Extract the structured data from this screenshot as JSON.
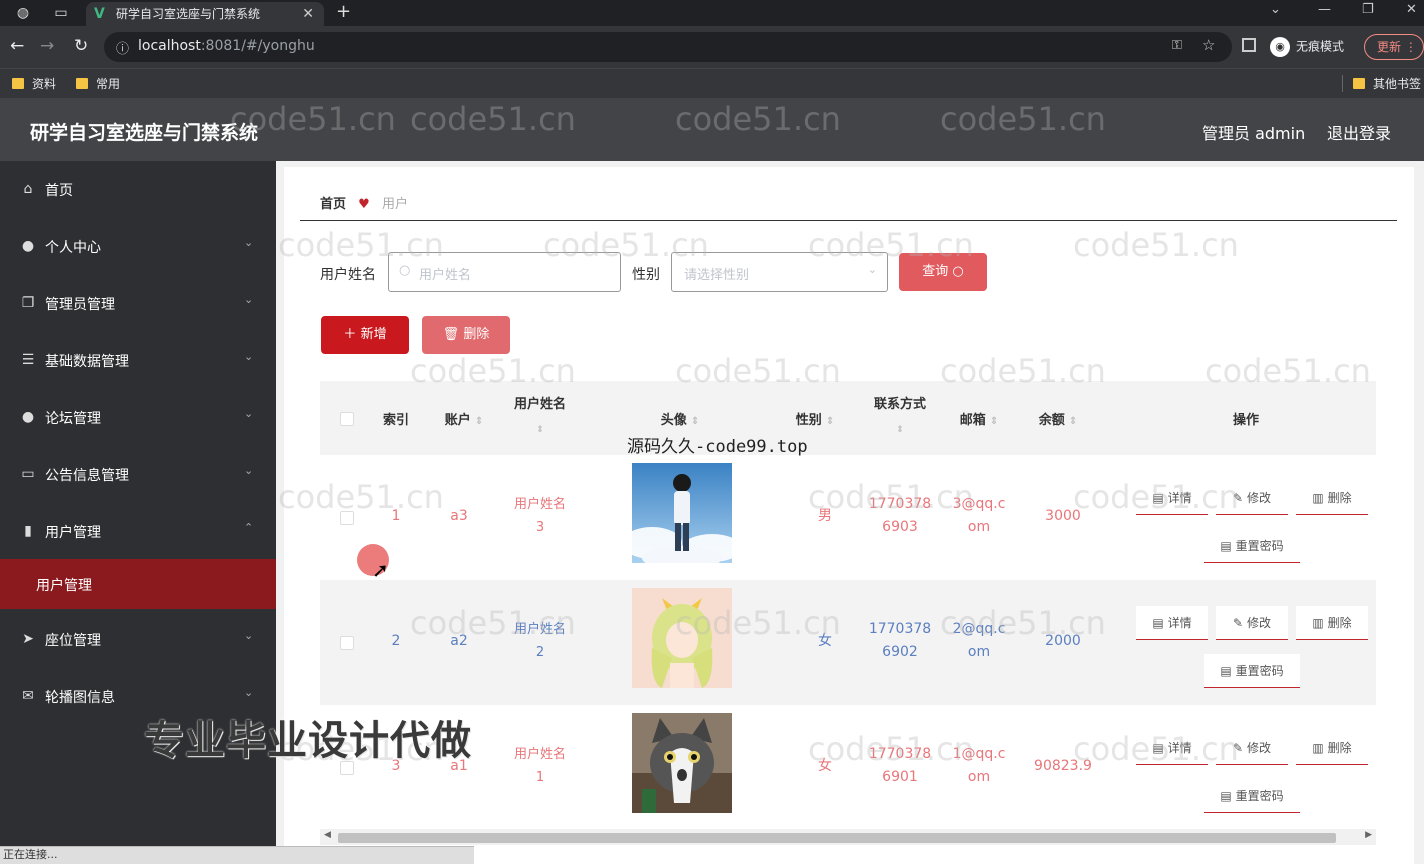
{
  "browser": {
    "tab_title": "研学自习室选座与门禁系统",
    "url_host": "localhost",
    "url_rest": ":8081/#/yonghu",
    "incognito_label": "无痕模式",
    "update_label": "更新",
    "bookmarks": [
      "资料",
      "常用"
    ],
    "other_bookmarks": "其他书签",
    "status_text": "正在连接..."
  },
  "header": {
    "app_title": "研学自习室选座与门禁系统",
    "user": "管理员 admin",
    "logout": "退出登录"
  },
  "sidebar": {
    "items": [
      {
        "label": "首页",
        "icon": "home-icon"
      },
      {
        "label": "个人中心",
        "icon": "user-icon"
      },
      {
        "label": "管理员管理",
        "icon": "copy-icon"
      },
      {
        "label": "基础数据管理",
        "icon": "list-icon"
      },
      {
        "label": "论坛管理",
        "icon": "bulb-icon"
      },
      {
        "label": "公告信息管理",
        "icon": "message-icon"
      },
      {
        "label": "用户管理",
        "icon": "chart-icon"
      },
      {
        "label": "座位管理",
        "icon": "send-icon"
      },
      {
        "label": "轮播图信息",
        "icon": "mail-icon"
      }
    ],
    "active_sub": "用户管理"
  },
  "breadcrumb": {
    "home": "首页",
    "current": "用户"
  },
  "search": {
    "name_label": "用户姓名",
    "name_placeholder": "用户姓名",
    "gender_label": "性别",
    "gender_placeholder": "请选择性别",
    "query_button": "查询"
  },
  "toolbar": {
    "add": "新增",
    "delete": "删除"
  },
  "table": {
    "headers": {
      "index": "索引",
      "account": "账户",
      "name": "用户姓名",
      "avatar": "头像",
      "gender": "性别",
      "contact": "联系方式",
      "email": "邮箱",
      "balance": "余额",
      "actions": "操作"
    },
    "action_labels": {
      "detail": "详情",
      "edit": "修改",
      "delete": "删除",
      "reset": "重置密码"
    },
    "rows": [
      {
        "index": "1",
        "account": "a3",
        "name1": "用户姓名",
        "name2": "3",
        "gender": "男",
        "phone1": "1770378",
        "phone2": "6903",
        "email1": "3@qq.c",
        "email2": "om",
        "balance": "3000",
        "color": "#e8767a"
      },
      {
        "index": "2",
        "account": "a2",
        "name1": "用户姓名",
        "name2": "2",
        "gender": "女",
        "phone1": "1770378",
        "phone2": "6902",
        "email1": "2@qq.c",
        "email2": "om",
        "balance": "2000",
        "color": "#5b7fc0"
      },
      {
        "index": "3",
        "account": "a1",
        "name1": "用户姓名",
        "name2": "1",
        "gender": "女",
        "phone1": "1770378",
        "phone2": "6901",
        "email1": "1@qq.c",
        "email2": "om",
        "balance": "90823.9",
        "color": "#e8767a"
      }
    ]
  },
  "overlays": {
    "code_text": "源码久久-code99.top",
    "ad_text": "专业毕业设计代做",
    "watermark": "code51.cn"
  },
  "colors": {
    "accent": "#c0252b",
    "sidebar_bg": "#2e2f32",
    "active_menu": "#8a1a1e"
  }
}
